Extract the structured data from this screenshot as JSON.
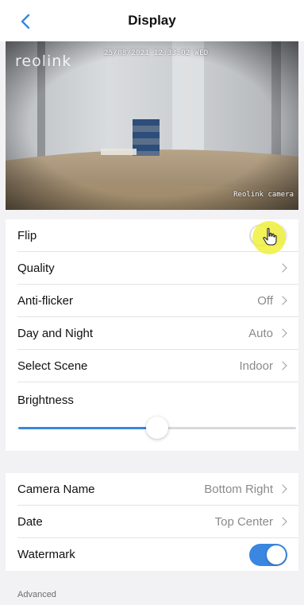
{
  "nav": {
    "title": "Display",
    "back_icon": "chevron-left-icon"
  },
  "preview": {
    "brand": "reolink",
    "timestamp": "25/08/2021 12:33:02 WED",
    "camera_name_overlay": "Reolink camera"
  },
  "settings": {
    "flip": {
      "label": "Flip",
      "on": false
    },
    "quality": {
      "label": "Quality",
      "value": ""
    },
    "anti_flicker": {
      "label": "Anti-flicker",
      "value": "Off"
    },
    "day_night": {
      "label": "Day and Night",
      "value": "Auto"
    },
    "scene": {
      "label": "Select Scene",
      "value": "Indoor"
    },
    "brightness": {
      "label": "Brightness",
      "level": 0.5
    }
  },
  "osd": {
    "camera_name": {
      "label": "Camera Name",
      "value": "Bottom Right"
    },
    "date": {
      "label": "Date",
      "value": "Top Center"
    },
    "watermark": {
      "label": "Watermark",
      "on": true
    }
  },
  "advanced_label": "Advanced",
  "colors": {
    "accent": "#3a86e0",
    "toggle_off": "#e9e9eb"
  }
}
